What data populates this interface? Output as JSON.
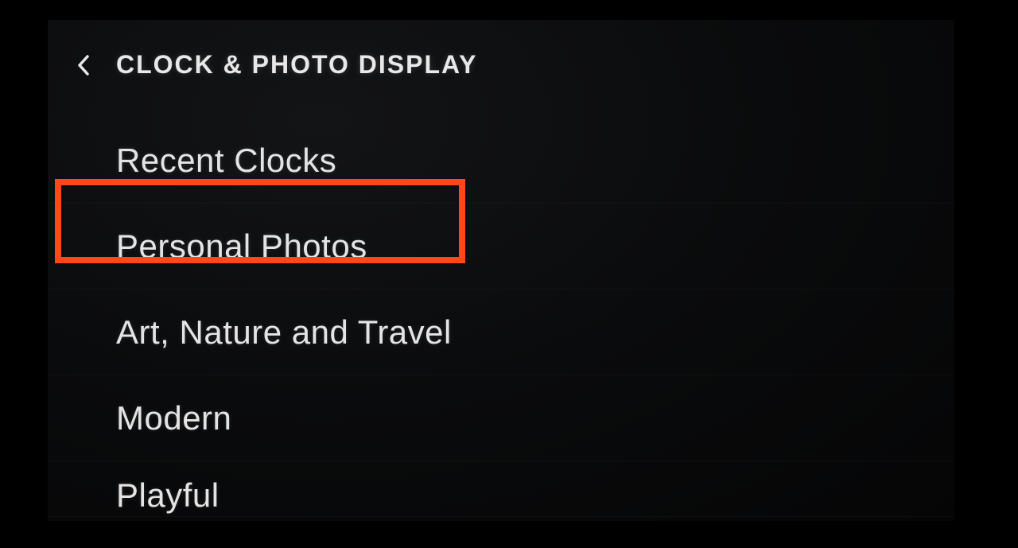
{
  "header": {
    "title": "CLOCK & PHOTO DISPLAY"
  },
  "menu": {
    "items": [
      {
        "label": "Recent Clocks"
      },
      {
        "label": "Personal Photos"
      },
      {
        "label": "Art, Nature and Travel"
      },
      {
        "label": "Modern"
      },
      {
        "label": "Playful"
      }
    ]
  },
  "highlight": {
    "color": "#ff4818",
    "target_index": 1
  }
}
